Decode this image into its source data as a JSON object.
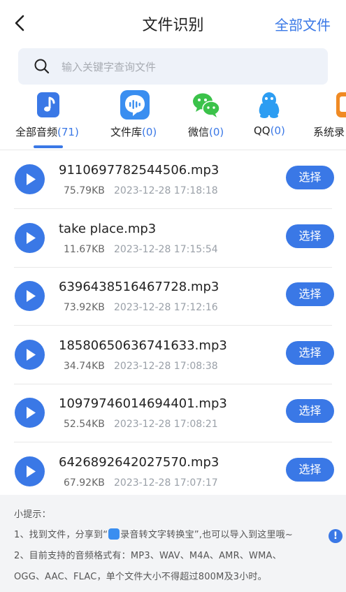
{
  "header": {
    "title": "文件识别",
    "all_files": "全部文件"
  },
  "search": {
    "placeholder": "输入关键字查询文件"
  },
  "tabs": [
    {
      "name": "全部音频",
      "count": "(71)",
      "icon": "music-note-icon"
    },
    {
      "name": "文件库",
      "count": "(0)",
      "icon": "voice-bubble-icon"
    },
    {
      "name": "微信",
      "count": "(0)",
      "icon": "wechat-icon"
    },
    {
      "name": "QQ",
      "count": "(0)",
      "icon": "qq-penguin-icon"
    },
    {
      "name": "系统录",
      "count": "",
      "icon": "recorder-icon"
    }
  ],
  "files": [
    {
      "name": "9110697782544506.mp3",
      "size": "75.79KB",
      "date": "2023-12-28 17:18:18",
      "action": "选择"
    },
    {
      "name": "take place.mp3",
      "size": "11.67KB",
      "date": "2023-12-28 17:15:54",
      "action": "选择"
    },
    {
      "name": "6396438516467728.mp3",
      "size": "73.92KB",
      "date": "2023-12-28 17:12:16",
      "action": "选择"
    },
    {
      "name": "18580650636741633.mp3",
      "size": "34.74KB",
      "date": "2023-12-28 17:08:38",
      "action": "选择"
    },
    {
      "name": "10979746014694401.mp3",
      "size": "52.54KB",
      "date": "2023-12-28 17:08:21",
      "action": "选择"
    },
    {
      "name": "6426892642027570.mp3",
      "size": "67.92KB",
      "date": "2023-12-28 17:07:17",
      "action": "选择"
    }
  ],
  "tips": {
    "heading": "小提示：",
    "line1_prefix": "1、找到文件，分享到“",
    "line1_suffix": "录音转文字转换宝”,也可以导入到这里哦~",
    "line2": "2、目前支持的音频格式有：MP3、WAV、M4A、AMR、WMA、",
    "line3": "OGG、AAC、FLAC，单个文件大小不得超过800M及3小时。",
    "alert": "!"
  },
  "colors": {
    "accent": "#3a78e6",
    "wechat": "#3bc24a",
    "qq": "#2d9df2",
    "tips_bg": "#f3f4f6"
  }
}
